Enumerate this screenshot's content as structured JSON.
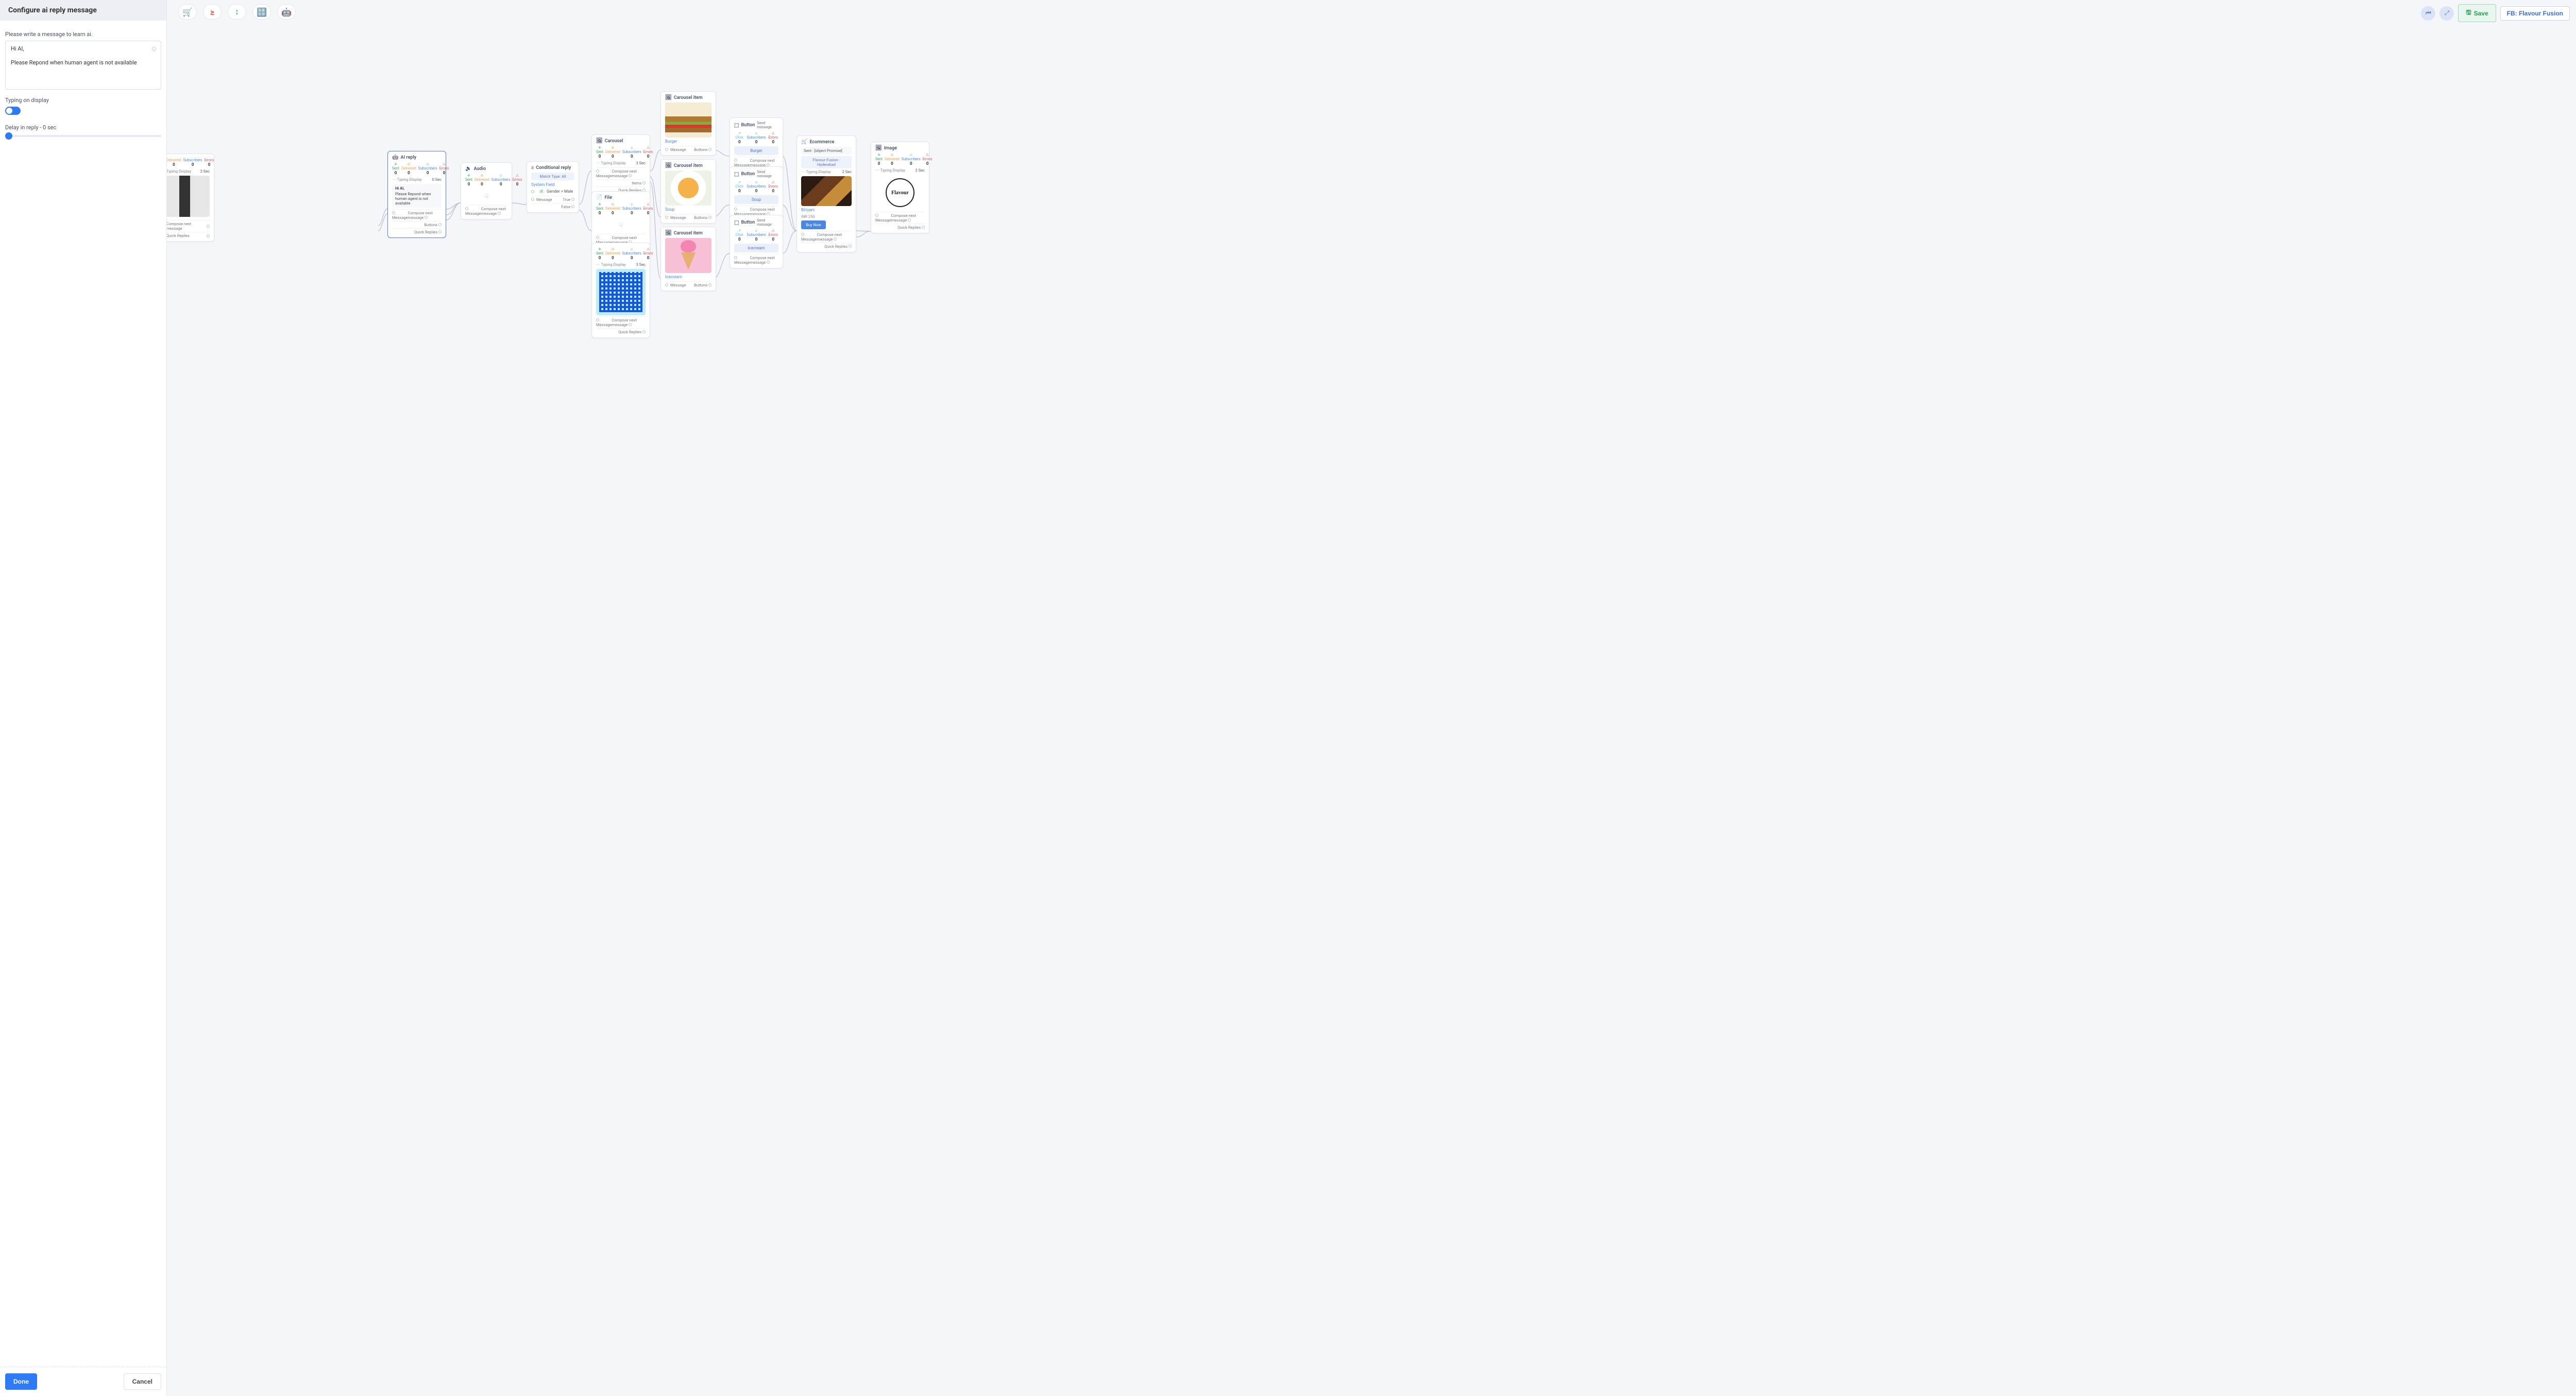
{
  "panel": {
    "title": "Configure ai reply message",
    "prompt": "Please write a message to learn ai.",
    "msg_line1": "Hi AI,",
    "msg_line2": "Please Repond when human agent is not available",
    "typing_label": "Typing on display",
    "delay_label": "Delay in reply  -  0 sec",
    "done": "Done",
    "cancel": "Cancel"
  },
  "topbar": {
    "t1": "🛒",
    "t2": "≥",
    "t3": "↕",
    "t4": "🔠",
    "t5": "🤖",
    "save": "Save",
    "fb": "FB: Flavour Fusion",
    "c1": "⏮",
    "c2": "⤢"
  },
  "stats": {
    "sent": "Sent",
    "delivered": "Delivered",
    "subs": "Subscribers",
    "errors": "Errors",
    "click": "Click",
    "zero": "0"
  },
  "labels": {
    "message": "Message",
    "compose": "Compose next message",
    "quick": "Quick Replies",
    "buttons": "Buttons",
    "items": "Items",
    "typing": "Typing Display",
    "typing_dots": "···· Typing Display",
    "sec0": "0 Sec",
    "sec2": "2 Sec",
    "sec3": "3 Sec",
    "true": "True",
    "false": "False",
    "send_msg": "Send message"
  },
  "nodes": {
    "partial": {
      "typing": "Typing Display",
      "sec": "2 Sec",
      "delivered": "Delivered",
      "subs": "Subscribers",
      "err": "Errors"
    },
    "ai": {
      "title": "AI reply",
      "msg_head": "Hi AI,",
      "msg_body": "Please Repond when human agent is not available"
    },
    "audio": {
      "title": "Audio"
    },
    "cond": {
      "title": "Conditional reply",
      "match": "Match Type: All",
      "sys": "System Field",
      "ifline": "Gender > Male",
      "if": "if"
    },
    "carousel": {
      "title": "Carousel"
    },
    "c_burger": {
      "title": "Carousel item",
      "cap": "Burger"
    },
    "c_soup": {
      "title": "Carousel item",
      "cap": "Soup"
    },
    "c_ice": {
      "title": "Carousel item",
      "cap": "Icecream"
    },
    "btn_burger": {
      "title": "Button",
      "pill": "Burger"
    },
    "btn_soup": {
      "title": "Button",
      "pill": "Soup"
    },
    "btn_ice": {
      "title": "Button",
      "pill": "Icecream"
    },
    "file": {
      "title": "File"
    },
    "ecom": {
      "title": "Ecommerce",
      "sent": "Sent : [object Promise]",
      "chip": "Flavour Fusion - Hyderabad",
      "prod": "Biriyani",
      "price": "INR 250",
      "buy": "Buy Now"
    },
    "image": {
      "title": "Image",
      "logo": "Flavour"
    }
  }
}
